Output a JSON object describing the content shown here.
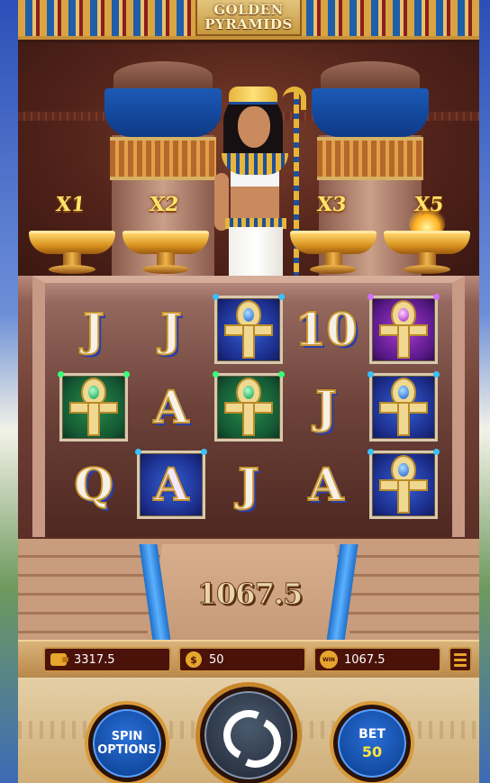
{
  "game": {
    "title_line1": "GOLDEN",
    "title_line2": "PYRAMIDS"
  },
  "multipliers": [
    "X1",
    "X2",
    "X3",
    "X5"
  ],
  "reels": [
    [
      {
        "symbol": "J",
        "type": "letter"
      },
      {
        "symbol": "J",
        "type": "letter"
      },
      {
        "symbol": "ankh-blue",
        "type": "framed",
        "color": "blue"
      },
      {
        "symbol": "10",
        "type": "letter"
      },
      {
        "symbol": "ankh-purple",
        "type": "framed",
        "color": "purple"
      }
    ],
    [
      {
        "symbol": "ankh-green",
        "type": "framed",
        "color": "green"
      },
      {
        "symbol": "A",
        "type": "letter"
      },
      {
        "symbol": "ankh-green",
        "type": "framed",
        "color": "green"
      },
      {
        "symbol": "J",
        "type": "letter"
      },
      {
        "symbol": "ankh-blue",
        "type": "framed",
        "color": "blue"
      }
    ],
    [
      {
        "symbol": "Q",
        "type": "letter"
      },
      {
        "symbol": "A",
        "type": "framed",
        "color": "blue"
      },
      {
        "symbol": "J",
        "type": "letter"
      },
      {
        "symbol": "A",
        "type": "letter"
      },
      {
        "symbol": "ankh-blue",
        "type": "framed",
        "color": "blue"
      }
    ]
  ],
  "win_total": "1067.5",
  "infobar": {
    "balance": "3317.5",
    "balance_icon": "wallet-icon",
    "bet": "50",
    "bet_icon": "coin-icon",
    "bet_icon_glyph": "$",
    "win": "1067.5",
    "win_icon": "win-icon",
    "win_icon_glyph": "WIN"
  },
  "controls": {
    "spin_options_line1": "SPIN",
    "spin_options_line2": "OPTIONS",
    "bet_label": "BET",
    "bet_value": "50"
  },
  "colors": {
    "frame_gold": "#c99244",
    "panel_dark": "#4a1208",
    "button_blue": "#124aa0",
    "bet_value_yellow": "#ffe43a"
  }
}
